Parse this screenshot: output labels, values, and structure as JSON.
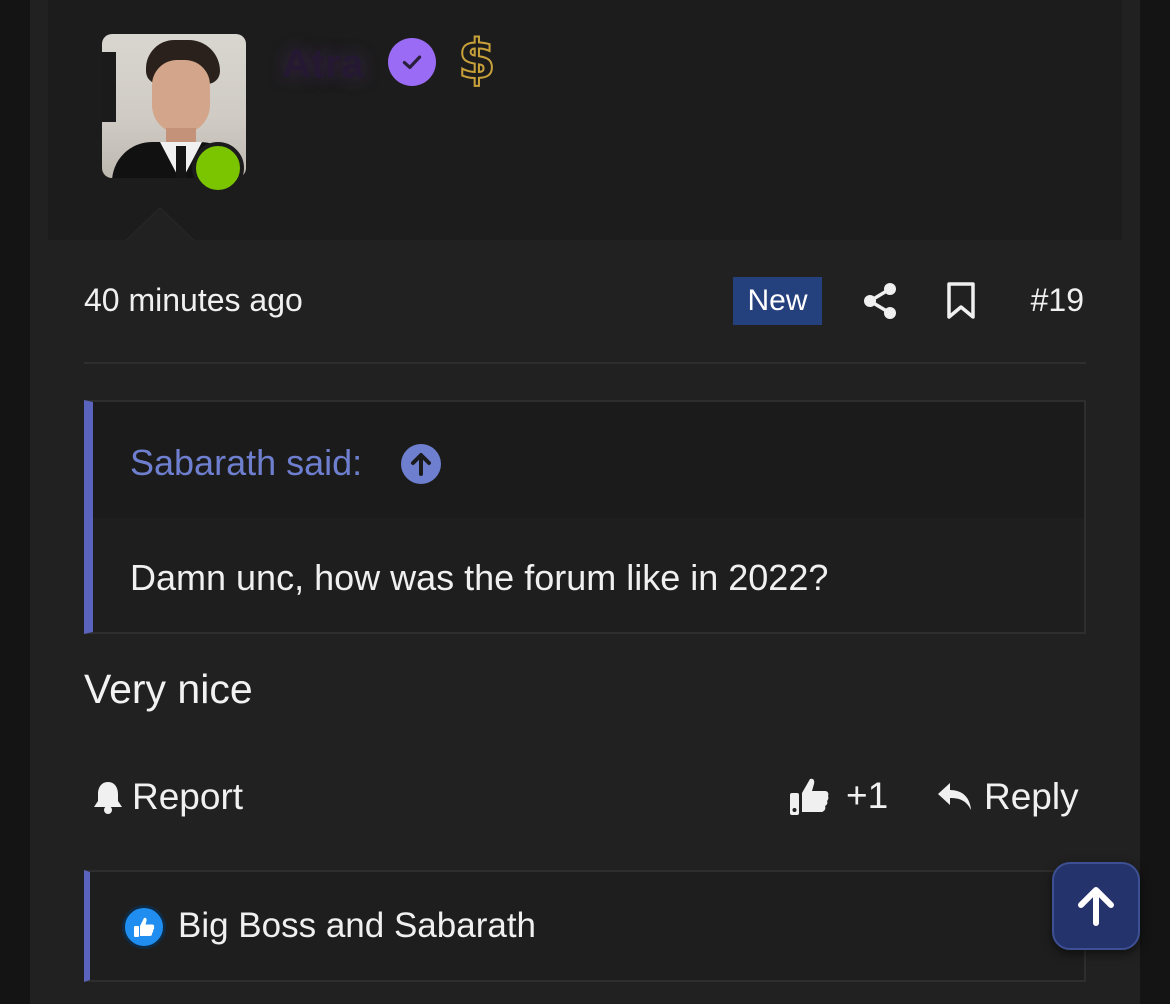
{
  "user": {
    "name": "Atra",
    "verified_icon": "verified-check-icon",
    "premium_icon": "dollar-icon",
    "status": "online",
    "status_color": "#7bc400"
  },
  "post": {
    "timestamp": "40 minutes ago",
    "new_badge": "New",
    "share_icon": "share-icon",
    "bookmark_icon": "bookmark-icon",
    "number": "#19",
    "message": "Very nice"
  },
  "quote": {
    "author_label": "Sabarath said:",
    "jump_icon": "arrow-up-circle-icon",
    "text": "Damn unc, how was the forum like in 2022?"
  },
  "actions": {
    "report_label": "Report",
    "like_label": "+1",
    "reply_label": "Reply"
  },
  "reactions": {
    "icon": "thumbs-up-reaction-icon",
    "text": "Big Boss and Sabarath"
  },
  "colors": {
    "accent": "#5a63bd",
    "link": "#6f7fcf",
    "new_badge_bg": "#24407d",
    "scroll_button_bg": "#24336b"
  }
}
